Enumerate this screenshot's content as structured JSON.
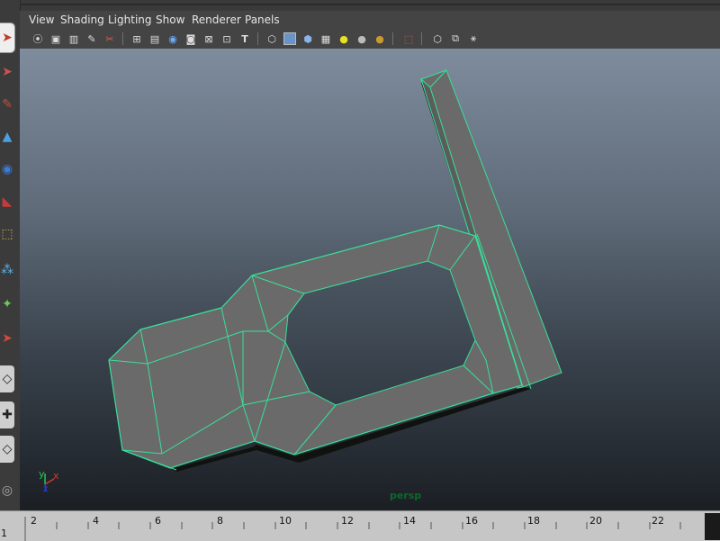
{
  "menubar": {
    "items": [
      "View",
      "Shading",
      "Lighting",
      "Show",
      "Renderer",
      "Panels"
    ]
  },
  "toolbar_icons": [
    "select-camera-icon",
    "camera-attributes-icon",
    "bookmark-icon",
    "image-plane-icon",
    "2d-pan-zoom-icon",
    "grease-pencil-icon",
    "grid-icon",
    "film-gate-icon",
    "resolution-gate-icon",
    "gate-mask-icon",
    "field-chart-icon",
    "safe-action-icon",
    "safe-title-icon",
    "wireframe-icon",
    "smooth-shade-icon",
    "bounding-box-icon",
    "textured-icon",
    "use-all-lights-icon",
    "shadows-icon",
    "screen-space-ao-icon",
    "xray-icon",
    "isolate-select-icon",
    "default-quality-icon",
    "hud-icon"
  ],
  "viewport": {
    "camera": "persp",
    "axis_labels": {
      "x": "x",
      "y": "y",
      "z": "z"
    }
  },
  "timeline": {
    "tick_labels": [
      "2",
      "4",
      "6",
      "8",
      "10",
      "12",
      "14",
      "16",
      "18",
      "20",
      "22"
    ],
    "current_frame": "1"
  },
  "colors": {
    "wireframe_highlight": "#38e09a",
    "mesh_face": "#696969",
    "camera_label": "#0a6a2c",
    "axis_x": "#d23b2b",
    "axis_y": "#2fc15a",
    "axis_z": "#2a3bd6"
  }
}
